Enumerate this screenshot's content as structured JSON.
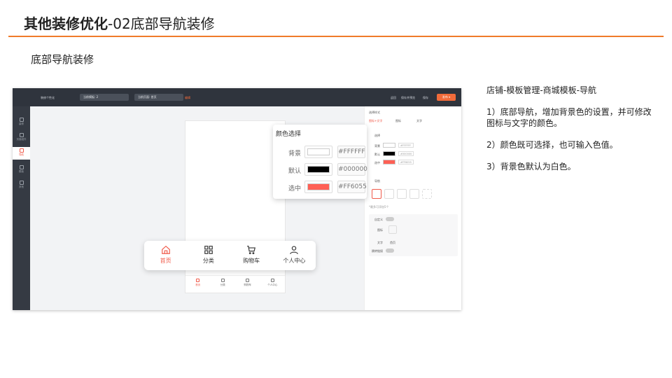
{
  "header": {
    "title_strong": "其他装修优化",
    "title_rest": "-02底部导航装修",
    "section_title": "底部导航装修"
  },
  "screenshot": {
    "topbar": {
      "back_label": "装修个性化",
      "template_select": "当前模板: 2",
      "page_select": "当前页面: 首页",
      "page_status": "编辑",
      "right_actions": [
        "返回",
        "保存并预览",
        "保存"
      ],
      "publish_label": "发布 ▾"
    },
    "leftnav": {
      "items": [
        {
          "label": "装修",
          "icon": "brush-icon",
          "active": false
        },
        {
          "label": "页面组件",
          "icon": "page-icon",
          "active": false
        },
        {
          "label": "导航",
          "icon": "nav-icon",
          "active": true
        },
        {
          "label": "模板",
          "icon": "template-icon",
          "active": false
        },
        {
          "label": "其他",
          "icon": "heart-icon",
          "active": false
        }
      ]
    },
    "mini_tabbar": [
      "首页",
      "分类",
      "购物车",
      "个人中心"
    ],
    "right_panel": {
      "style_label": "选择样式",
      "style_options": [
        "图标+文字",
        "图标",
        "文字"
      ],
      "color_section": "选择",
      "color_rows": [
        {
          "label": "背景",
          "hex": "#FFFFFF",
          "color": "#FFFFFF"
        },
        {
          "label": "默认",
          "hex": "#000000",
          "color": "#000000"
        },
        {
          "label": "选中",
          "hex": "#FF6055",
          "color": "#FF6055"
        }
      ],
      "nav_section": "导航",
      "note": "*最多可添加5个",
      "custom_label": "自定义",
      "icon_label": "图标",
      "text_label": "文字",
      "text_value": "首页",
      "link_label": "跳转链接"
    },
    "color_popup": {
      "title": "颜色选择",
      "rows": [
        {
          "label": "背景",
          "hex": "#FFFFFF",
          "color": "#FFFFFF"
        },
        {
          "label": "默认",
          "hex": "#000000",
          "color": "#000000"
        },
        {
          "label": "选中",
          "hex": "#FF6055",
          "color": "#FF6055"
        }
      ]
    },
    "float_tabbar": [
      {
        "label": "首页",
        "icon": "home-icon",
        "active": true
      },
      {
        "label": "分类",
        "icon": "grid-icon",
        "active": false
      },
      {
        "label": "购物车",
        "icon": "cart-icon",
        "active": false
      },
      {
        "label": "个人中心",
        "icon": "user-icon",
        "active": false
      }
    ],
    "accent_color": "#F05A4A"
  },
  "notes": {
    "heading": "店铺-模板管理-商城模板-导航",
    "items": [
      "1）底部导航，增加背景色的设置，并可修改图标与文字的颜色。",
      "2）颜色既可选择，也可输入色值。",
      "3）背景色默认为白色。"
    ]
  }
}
